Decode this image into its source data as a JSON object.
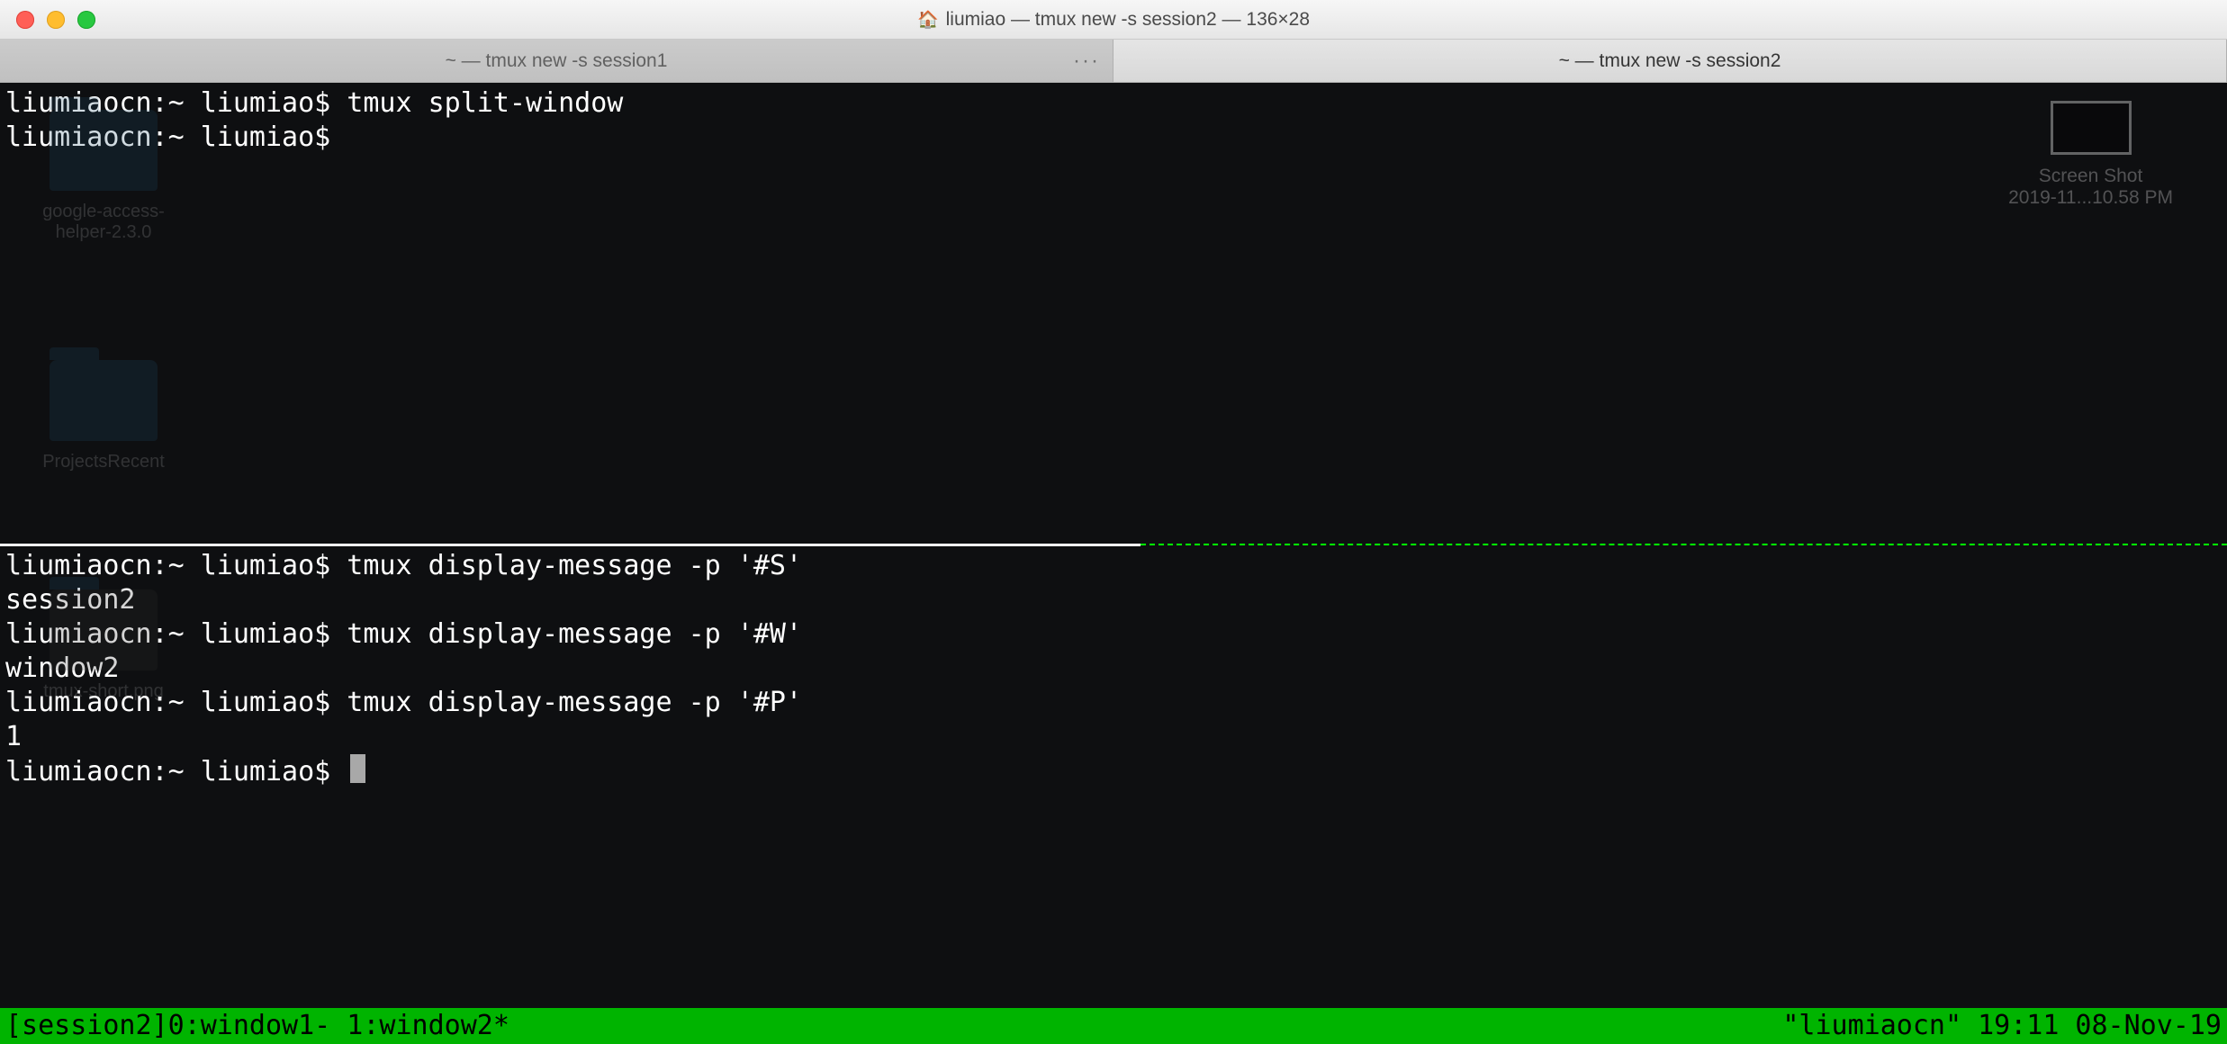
{
  "window": {
    "title": "liumiao — tmux new -s session2 — 136×28"
  },
  "tabs": [
    {
      "label": "~ — tmux new -s session1",
      "active": false,
      "overflow": "···"
    },
    {
      "label": "~ — tmux new -s session2",
      "active": true
    }
  ],
  "desktop_ghost": {
    "items": [
      "google-access-\nhelper-2.3.0",
      "ProjectsRecent",
      "tmux-short.png"
    ],
    "right_thumb_line1": "Screen Shot",
    "right_thumb_line2": "2019-11...10.58 PM"
  },
  "pane_top": {
    "lines": [
      "liumiaocn:~ liumiao$ tmux split-window",
      "liumiaocn:~ liumiao$"
    ]
  },
  "pane_bottom": {
    "lines": [
      "liumiaocn:~ liumiao$ tmux display-message -p '#S'",
      "session2",
      "liumiaocn:~ liumiao$ tmux display-message -p '#W'",
      "window2",
      "liumiaocn:~ liumiao$ tmux display-message -p '#P'",
      "1",
      "liumiaocn:~ liumiao$ "
    ]
  },
  "status": {
    "left": "[session2]0:window1- 1:window2*",
    "right": "\"liumiaocn\" 19:11 08-Nov-19"
  }
}
